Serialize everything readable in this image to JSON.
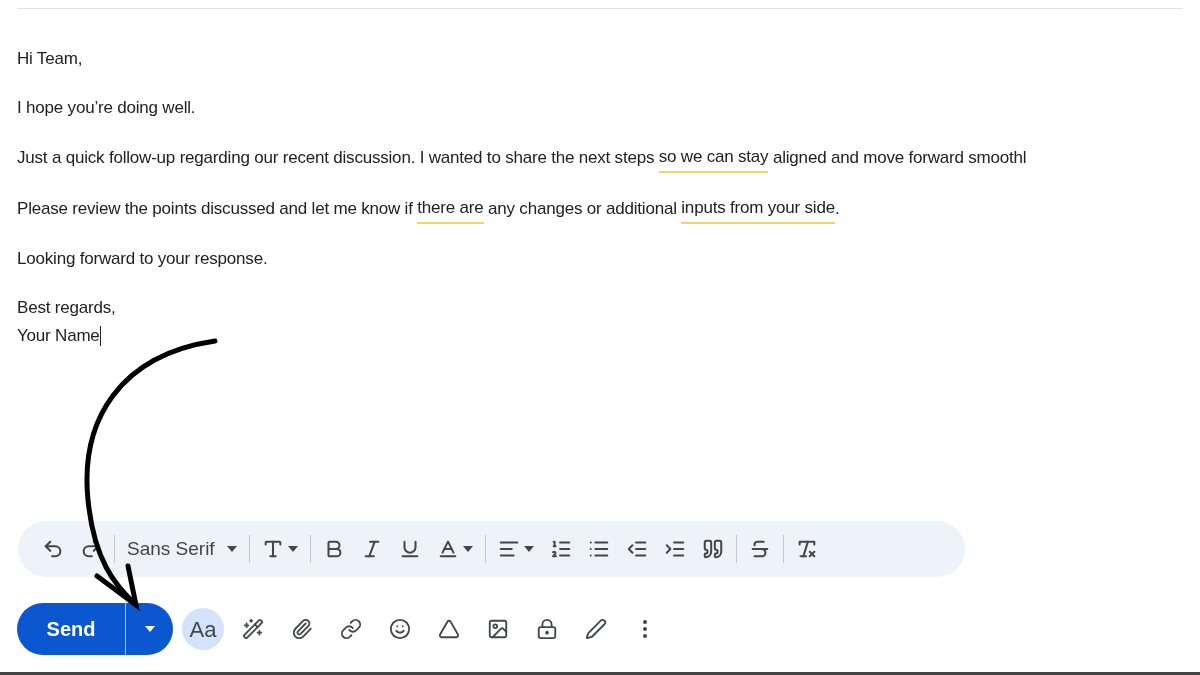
{
  "body": {
    "paragraphs": [
      {
        "cursor_at_end": false,
        "lines": [
          [
            {
              "text": "Hi Team,",
              "flagged": false
            }
          ]
        ]
      },
      {
        "cursor_at_end": false,
        "lines": [
          [
            {
              "text": "I hope you’re doing well.",
              "flagged": false
            }
          ]
        ]
      },
      {
        "cursor_at_end": false,
        "lines": [
          [
            {
              "text": "Just a quick follow-up regarding our recent discussion. I wanted to share the next steps ",
              "flagged": false
            },
            {
              "text": "so we can stay",
              "flagged": true
            },
            {
              "text": " aligned and move forward smoothl",
              "flagged": false
            }
          ]
        ]
      },
      {
        "cursor_at_end": false,
        "lines": [
          [
            {
              "text": "Please review the points discussed and let me know if ",
              "flagged": false
            },
            {
              "text": "there are",
              "flagged": true
            },
            {
              "text": " any changes or additional ",
              "flagged": false
            },
            {
              "text": "inputs from your side",
              "flagged": true
            },
            {
              "text": ".",
              "flagged": false
            }
          ]
        ]
      },
      {
        "cursor_at_end": false,
        "lines": [
          [
            {
              "text": "Looking forward to your response.",
              "flagged": false
            }
          ]
        ]
      },
      {
        "cursor_at_end": true,
        "lines": [
          [
            {
              "text": "Best regards,",
              "flagged": false
            }
          ],
          [
            {
              "text": "Your Name",
              "flagged": false
            }
          ]
        ]
      }
    ]
  },
  "formatting_toolbar": {
    "font": "Sans Serif"
  },
  "send_bar": {
    "send_label": "Send",
    "format_toggle": {
      "label": "Aa",
      "selected": true
    }
  }
}
